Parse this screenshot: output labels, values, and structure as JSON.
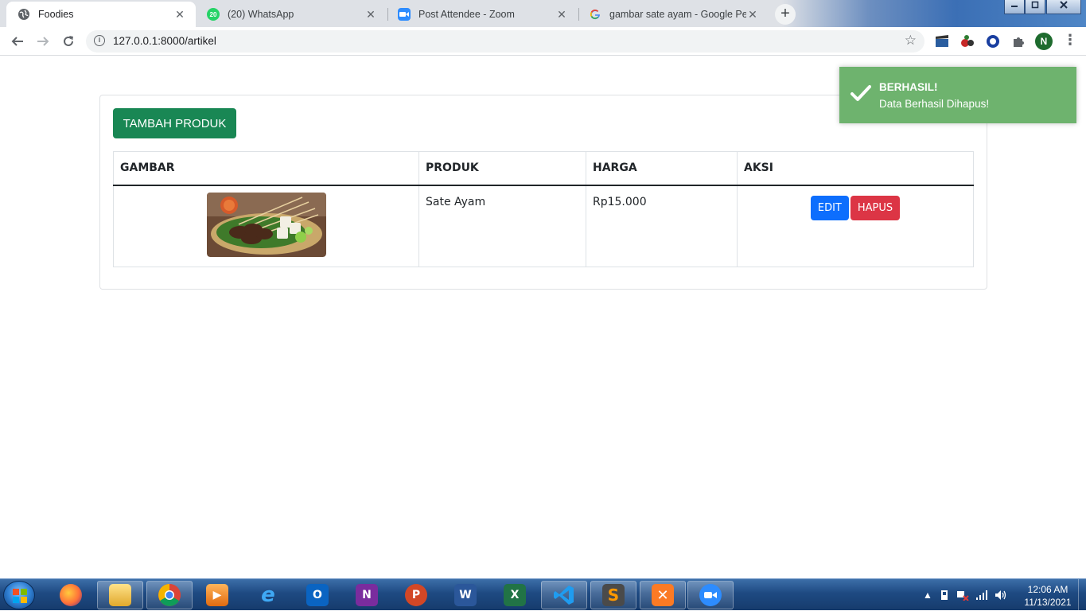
{
  "browser": {
    "tabs": [
      {
        "title": "Foodies",
        "icon": "globe-icon",
        "active": true
      },
      {
        "title": "(20) WhatsApp",
        "icon": "whatsapp-icon",
        "badge": "20",
        "active": false
      },
      {
        "title": "Post Attendee - Zoom",
        "icon": "zoom-icon",
        "active": false
      },
      {
        "title": "gambar sate ayam - Google Pene",
        "icon": "google-icon",
        "active": false
      }
    ],
    "close_glyph": "✕",
    "new_tab_glyph": "+",
    "url": "127.0.0.1:8000/artikel",
    "profile_initial": "N"
  },
  "page": {
    "add_button_label": "TAMBAH PRODUK",
    "table": {
      "headers": [
        "GAMBAR",
        "PRODUK",
        "HARGA",
        "AKSI"
      ],
      "rows": [
        {
          "image": "sate-ayam-photo",
          "produk": "Sate Ayam",
          "harga": "Rp15.000",
          "edit_label": "EDIT",
          "delete_label": "HAPUS"
        }
      ]
    }
  },
  "toast": {
    "title": "BERHASIL!",
    "message": "Data Berhasil Dihapus!",
    "color": "#6eb36e"
  },
  "taskbar": {
    "apps": [
      "firefox",
      "file-explorer",
      "chrome",
      "media-player",
      "internet-explorer",
      "outlook",
      "onenote",
      "powerpoint",
      "word",
      "excel",
      "vscode",
      "sublime-text",
      "xampp",
      "zoom"
    ],
    "time": "12:06 AM",
    "date": "11/13/2021"
  },
  "colors": {
    "success": "#198754",
    "primary": "#0d6efd",
    "danger": "#dc3545"
  }
}
